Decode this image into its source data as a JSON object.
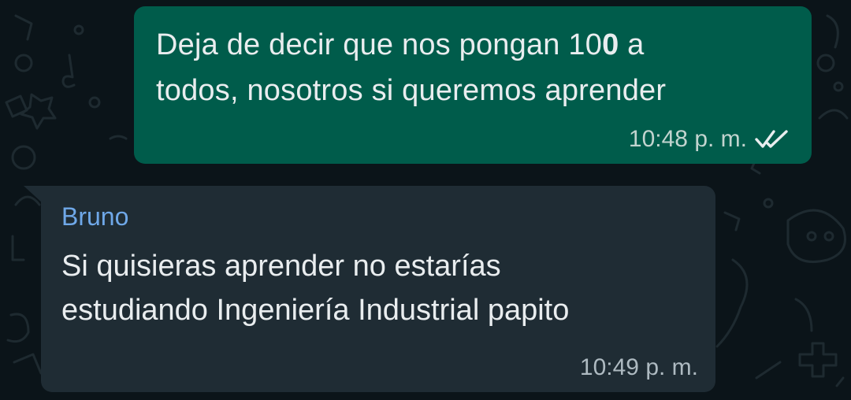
{
  "conversation": {
    "outgoing": {
      "text_part1": "Deja de decir que nos pongan 10",
      "text_bold": "0",
      "text_part2": " a todos, nosotros si queremos aprender",
      "time": "10:48 p. m.",
      "status_icon": "double-check-read-icon"
    },
    "incoming": {
      "sender": "Bruno",
      "text": "Si quisieras aprender no estarías estudiando Ingeniería Industrial papito",
      "time": "10:49 p. m."
    }
  },
  "colors": {
    "background": "#0b1419",
    "outgoing_bubble": "#005c4b",
    "incoming_bubble": "#1f2c34",
    "sender_name": "#6fa8e8",
    "text": "#e9edef"
  }
}
